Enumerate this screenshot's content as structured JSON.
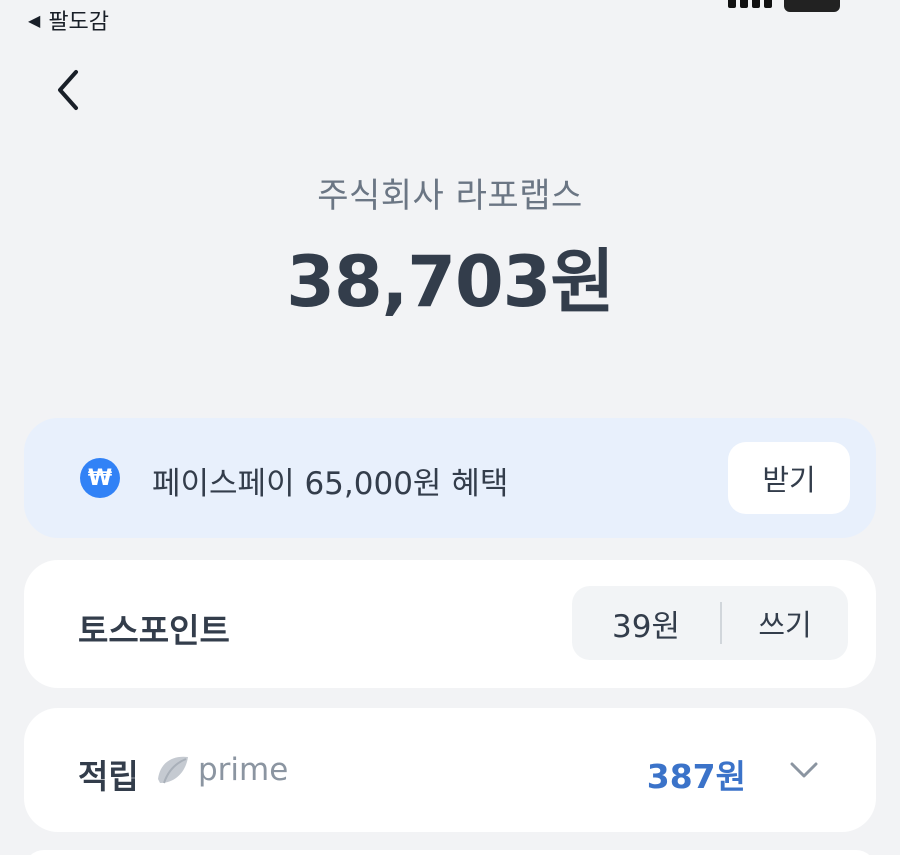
{
  "status_bar": {
    "back_app_label": "팔도감"
  },
  "header": {
    "merchant": "주식회사 라포랩스",
    "amount": "38,703원"
  },
  "promo": {
    "icon_glyph": "₩",
    "text": "페이스페이 65,000원 혜택",
    "button_label": "받기"
  },
  "points": {
    "label": "토스포인트",
    "balance": "39원",
    "use_label": "쓰기"
  },
  "earn": {
    "label": "적립",
    "prime_text": "prime",
    "value": "387원"
  },
  "colors": {
    "background": "#f2f3f5",
    "accent_blue": "#3182f6",
    "earn_value": "#3b73c9",
    "promo_bg": "#e8f0fc"
  }
}
